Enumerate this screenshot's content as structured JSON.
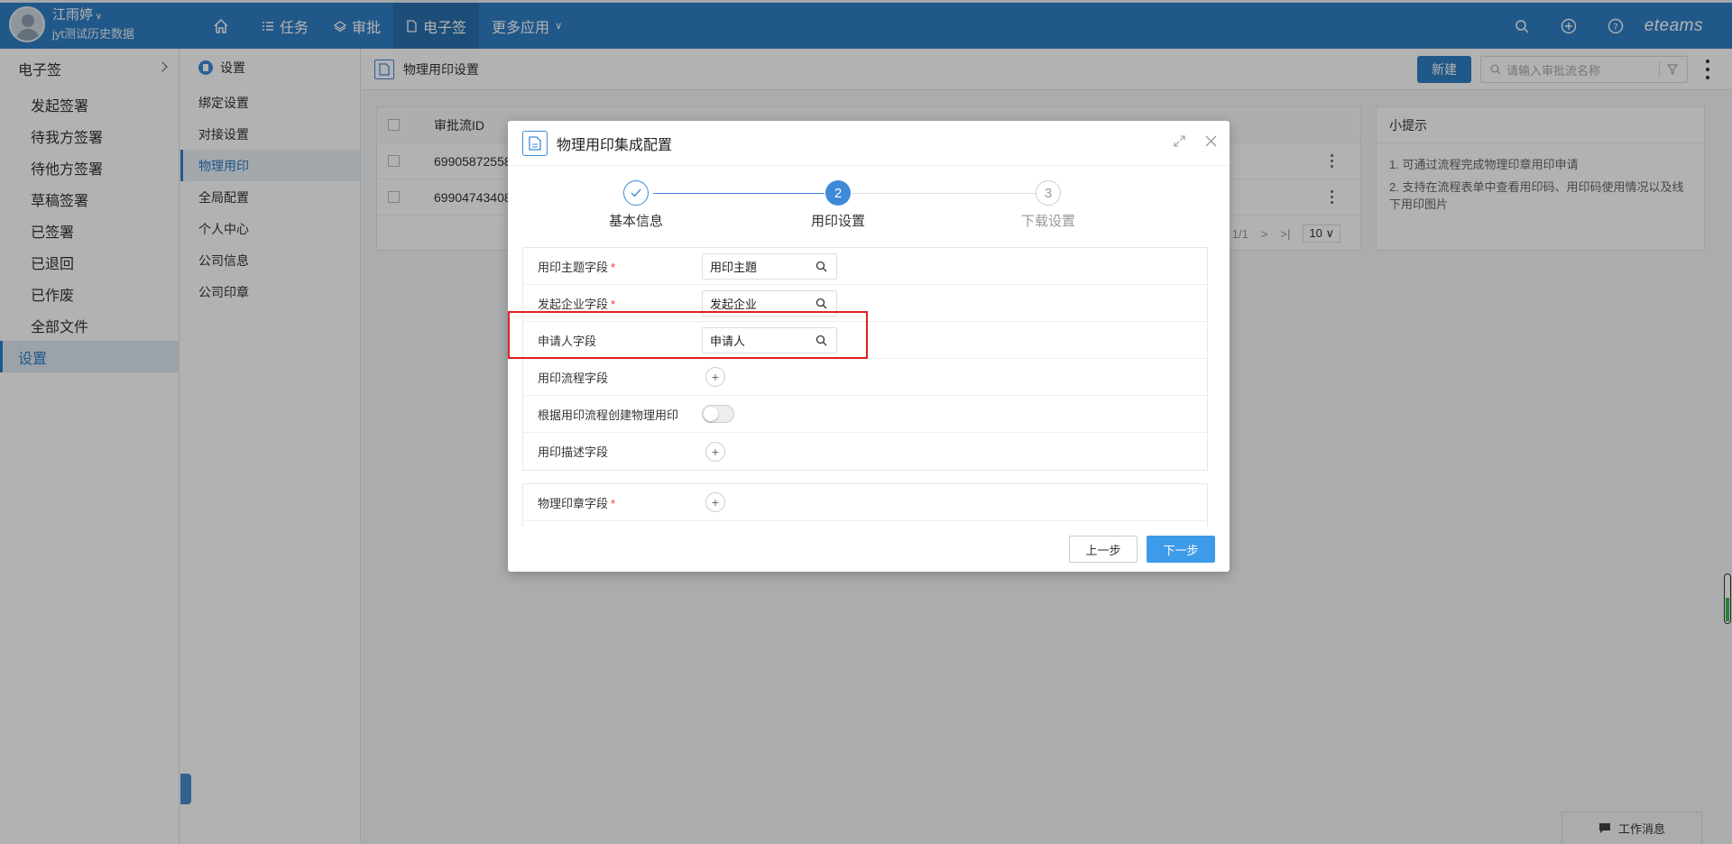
{
  "topbar": {
    "user_name": "江雨婷",
    "user_sub": "jyt测试历史数据",
    "nav": [
      {
        "label": ""
      },
      {
        "label": "任务"
      },
      {
        "label": "审批"
      },
      {
        "label": "电子签"
      },
      {
        "label": "更多应用"
      }
    ],
    "brand": "eteams"
  },
  "leftmenu": {
    "head": "电子签",
    "items": [
      "发起签署",
      "待我方签署",
      "待他方签署",
      "草稿签署",
      "已签署",
      "已退回",
      "已作废",
      "全部文件",
      "设置"
    ]
  },
  "submenu": {
    "head": "设置",
    "items": [
      "绑定设置",
      "对接设置",
      "物理用印",
      "全局配置",
      "个人中心",
      "公司信息",
      "公司印章"
    ]
  },
  "page": {
    "title": "物理用印设置",
    "new_button": "新建",
    "search_placeholder": "请输入审批流名称",
    "table": {
      "col_id": "审批流ID",
      "rows": [
        {
          "id": "69905872558"
        },
        {
          "id": "69904743408"
        }
      ],
      "pager_text": "1/1",
      "page_size": "10"
    },
    "tips": {
      "title": "小提示",
      "items": [
        "1. 可通过流程完成物理印章用印申请",
        "2. 支持在流程表单中查看用印码、用印码使用情况以及线下用印图片"
      ]
    }
  },
  "modal": {
    "title": "物理用印集成配置",
    "steps": [
      {
        "num": "✓",
        "label": "基本信息"
      },
      {
        "num": "2",
        "label": "用印设置"
      },
      {
        "num": "3",
        "label": "下载设置"
      }
    ],
    "fields": [
      {
        "label": "用印主题字段",
        "required": "*",
        "value": "用印主題"
      },
      {
        "label": "发起企业字段",
        "required": "*",
        "value": "发起企业"
      },
      {
        "label": "申请人字段",
        "required": "",
        "value": "申请人"
      },
      {
        "label": "用印流程字段"
      },
      {
        "label": "根据用印流程创建物理用印",
        "toggle_on": false
      },
      {
        "label": "用印描述字段"
      }
    ],
    "fields2": [
      {
        "label": "物理印章字段",
        "required": "*"
      }
    ],
    "prev_button": "上一步",
    "next_button": "下一步"
  },
  "widget": {
    "work_msg": "工作消息"
  },
  "colors": {
    "topbar": "#2f7fc5",
    "accent": "#3d8ad8",
    "highlight": "#e02020"
  }
}
